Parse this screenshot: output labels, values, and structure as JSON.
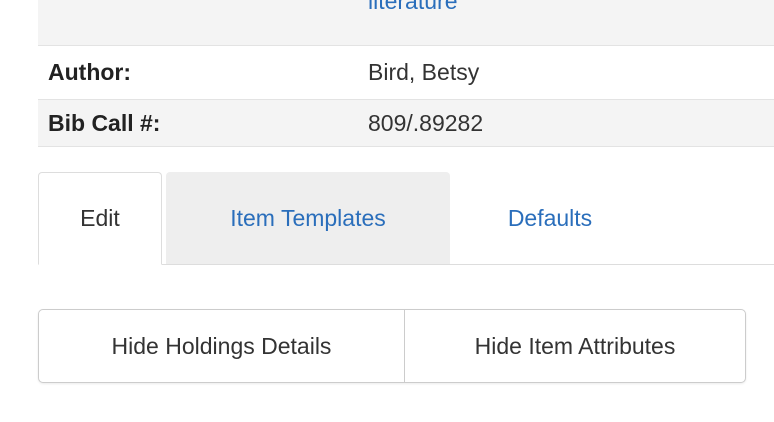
{
  "bib": {
    "subject_link": "literature",
    "rows": [
      {
        "label": "Author:",
        "value": "Bird, Betsy"
      },
      {
        "label": "Bib Call #:",
        "value": "809/.89282"
      }
    ]
  },
  "tabs": [
    {
      "label": "Edit",
      "active": true
    },
    {
      "label": "Item Templates",
      "active": false
    },
    {
      "label": "Defaults",
      "active": false
    }
  ],
  "buttons": {
    "hide_holdings": "Hide Holdings Details",
    "hide_attributes": "Hide Item Attributes"
  },
  "colors": {
    "link": "#2a6ebb",
    "row_shade": "#f4f4f4",
    "tab_hover_bg": "#eeeeee"
  }
}
